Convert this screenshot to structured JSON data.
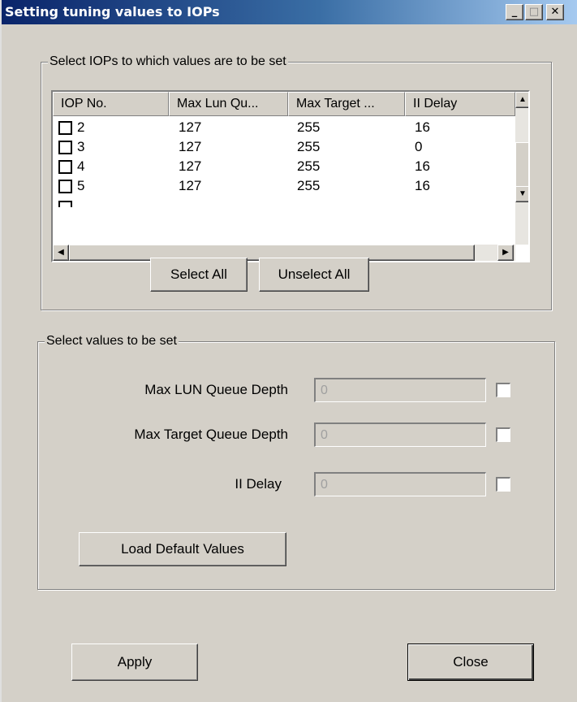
{
  "window": {
    "title": "Setting tuning values to IOPs",
    "minimize_glyph": "_",
    "maximize_glyph": "□",
    "close_glyph": "✕"
  },
  "iop_group": {
    "legend": "Select IOPs to which values are to be set",
    "columns": [
      "IOP No.",
      "Max Lun Qu...",
      "Max Target ...",
      "II Delay"
    ],
    "rows": [
      {
        "iop": "2",
        "max_lun": "127",
        "max_target": "255",
        "delay": "16",
        "checked": false
      },
      {
        "iop": "3",
        "max_lun": "127",
        "max_target": "255",
        "delay": "0",
        "checked": false
      },
      {
        "iop": "4",
        "max_lun": "127",
        "max_target": "255",
        "delay": "16",
        "checked": false
      },
      {
        "iop": "5",
        "max_lun": "127",
        "max_target": "255",
        "delay": "16",
        "checked": false
      }
    ],
    "select_all_label": "Select All",
    "unselect_all_label": "Unselect All"
  },
  "values_group": {
    "legend": "Select values to be set",
    "fields": [
      {
        "label": "Max LUN Queue Depth",
        "value": "0",
        "checked": false
      },
      {
        "label": "Max Target Queue Depth",
        "value": "0",
        "checked": false
      },
      {
        "label": "II Delay",
        "value": "0",
        "checked": false
      }
    ],
    "load_defaults_label": "Load Default Values"
  },
  "footer": {
    "apply_label": "Apply",
    "close_label": "Close"
  },
  "icons": {
    "scroll_up": "▲",
    "scroll_down": "▼",
    "scroll_left": "◀",
    "scroll_right": "▶"
  },
  "colors": {
    "titlebar_start": "#0a246a",
    "titlebar_end": "#a6caf0",
    "face": "#d4d0c8"
  }
}
